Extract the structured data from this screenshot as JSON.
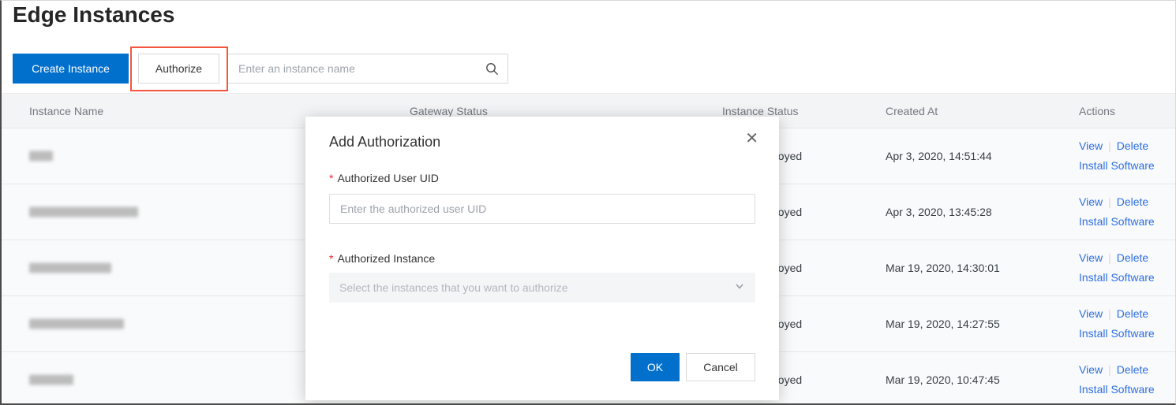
{
  "page": {
    "title": "Edge Instances"
  },
  "toolbar": {
    "create_button": "Create Instance",
    "authorize_button": "Authorize",
    "search_placeholder": "Enter an instance name"
  },
  "table": {
    "columns": [
      "Instance Name",
      "Gateway Status",
      "Instance Status",
      "Created At",
      "Actions"
    ],
    "action_labels": {
      "view": "View",
      "separator": "|",
      "delete": "Delete",
      "install": "Install Software"
    },
    "rows": [
      {
        "status": "Deployed",
        "created_at": "Apr 3, 2020, 14:51:44"
      },
      {
        "status": "Deployed",
        "created_at": "Apr 3, 2020, 13:45:28"
      },
      {
        "status": "Deployed",
        "created_at": "Mar 19, 2020, 14:30:01"
      },
      {
        "status": "Deployed",
        "created_at": "Mar 19, 2020, 14:27:55"
      },
      {
        "status": "Deployed",
        "created_at": "Mar 19, 2020, 10:47:45"
      }
    ]
  },
  "modal": {
    "title": "Add Authorization",
    "close_icon": "✕",
    "required_mark": "*",
    "user_uid_label": "Authorized User UID",
    "user_uid_placeholder": "Enter the authorized user UID",
    "instance_label": "Authorized Instance",
    "instance_placeholder": "Select the instances that you want to authorize",
    "ok_button": "OK",
    "cancel_button": "Cancel"
  },
  "colors": {
    "brand_blue": "#0070cc",
    "link_blue": "#2e6fe4",
    "annotation_orange": "#f5543f"
  }
}
